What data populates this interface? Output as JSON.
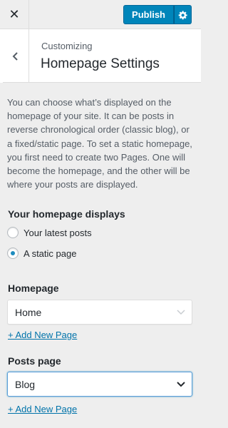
{
  "toolbar": {
    "close_symbol": "✕",
    "publish_label": "Publish",
    "settings_icon": "gear-icon"
  },
  "header": {
    "breadcrumb": "Customizing",
    "title": "Homepage Settings",
    "back_icon": "chevron-left-icon"
  },
  "description": "You can choose what’s displayed on the homepage of your site. It can be posts in reverse chronological order (classic blog), or a fixed/static page. To set a static homepage, you first need to create two Pages. One will become the homepage, and the other will be where your posts are displayed.",
  "homepage_displays": {
    "label": "Your homepage displays",
    "options": [
      {
        "label": "Your latest posts",
        "selected": false
      },
      {
        "label": "A static page",
        "selected": true
      }
    ]
  },
  "homepage": {
    "label": "Homepage",
    "value": "Home",
    "add_link": "+ Add New Page"
  },
  "posts_page": {
    "label": "Posts page",
    "value": "Blog",
    "add_link": "+ Add New Page"
  },
  "colors": {
    "accent": "#0085ba",
    "link": "#0073aa",
    "background": "#eeeeee"
  }
}
